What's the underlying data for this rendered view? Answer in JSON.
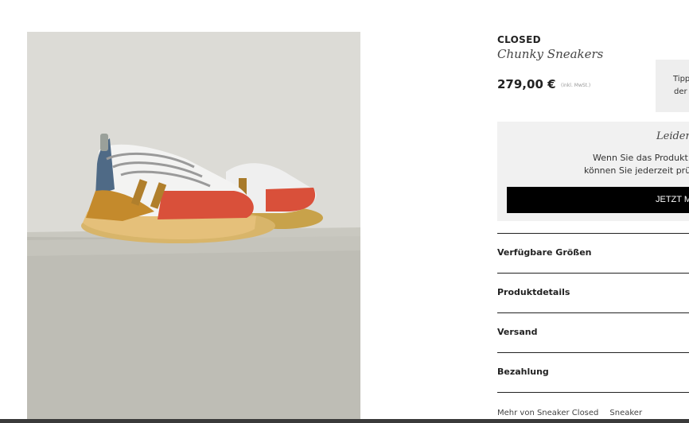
{
  "product": {
    "brand": "CLOSED",
    "name": "Chunky Sneakers",
    "price": "279,00 €",
    "price_note": "(inkl. MwSt.)"
  },
  "tip": {
    "line1": "Tipp",
    "line2": "der"
  },
  "notify": {
    "title": "Leider",
    "text_line1": "Wenn Sie das Produkt a",
    "text_line2": "können Sie jederzeit prüfe",
    "button_label": "JETZT M"
  },
  "accordion": {
    "items": [
      {
        "label": "Verfügbare Größen"
      },
      {
        "label": "Produktdetails"
      },
      {
        "label": "Versand"
      },
      {
        "label": "Bezahlung"
      }
    ]
  },
  "more": {
    "link1": "Mehr von Sneaker Closed",
    "link2": "Sneaker"
  },
  "colors": {
    "background": "#ffffff",
    "notify_box": "#f1f1f1",
    "button": "#000000",
    "divider": "#222222"
  }
}
